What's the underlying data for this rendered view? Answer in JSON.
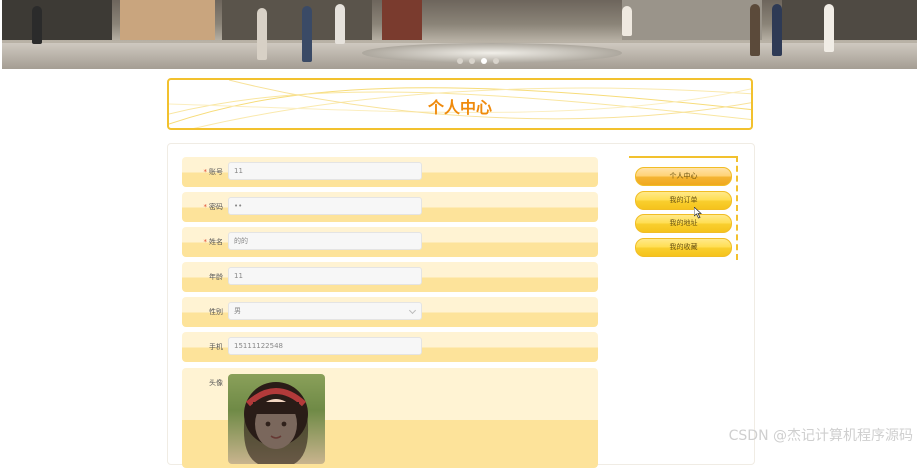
{
  "banner": {
    "slides": 4,
    "active_slide": 2
  },
  "page": {
    "title": "个人中心"
  },
  "form": {
    "account": {
      "label": "账号",
      "required": "*",
      "value": "11"
    },
    "password": {
      "label": "密码",
      "required": "*",
      "value": "••"
    },
    "name": {
      "label": "姓名",
      "required": "*",
      "value": "的的"
    },
    "age": {
      "label": "年龄",
      "value": "11"
    },
    "gender": {
      "label": "性别",
      "value": "男"
    },
    "phone": {
      "label": "手机",
      "value": "15111122548"
    },
    "avatar": {
      "label": "头像"
    }
  },
  "menu": {
    "items": [
      {
        "label": "个人中心"
      },
      {
        "label": "我的订单"
      },
      {
        "label": "我的地址"
      },
      {
        "label": "我的收藏"
      }
    ]
  },
  "watermark": "CSDN @杰记计算机程序源码",
  "colors": {
    "accent": "#f2c12e",
    "title": "#ef8a0c",
    "row_light": "#fff3d3",
    "row_dark": "#fde39a"
  }
}
